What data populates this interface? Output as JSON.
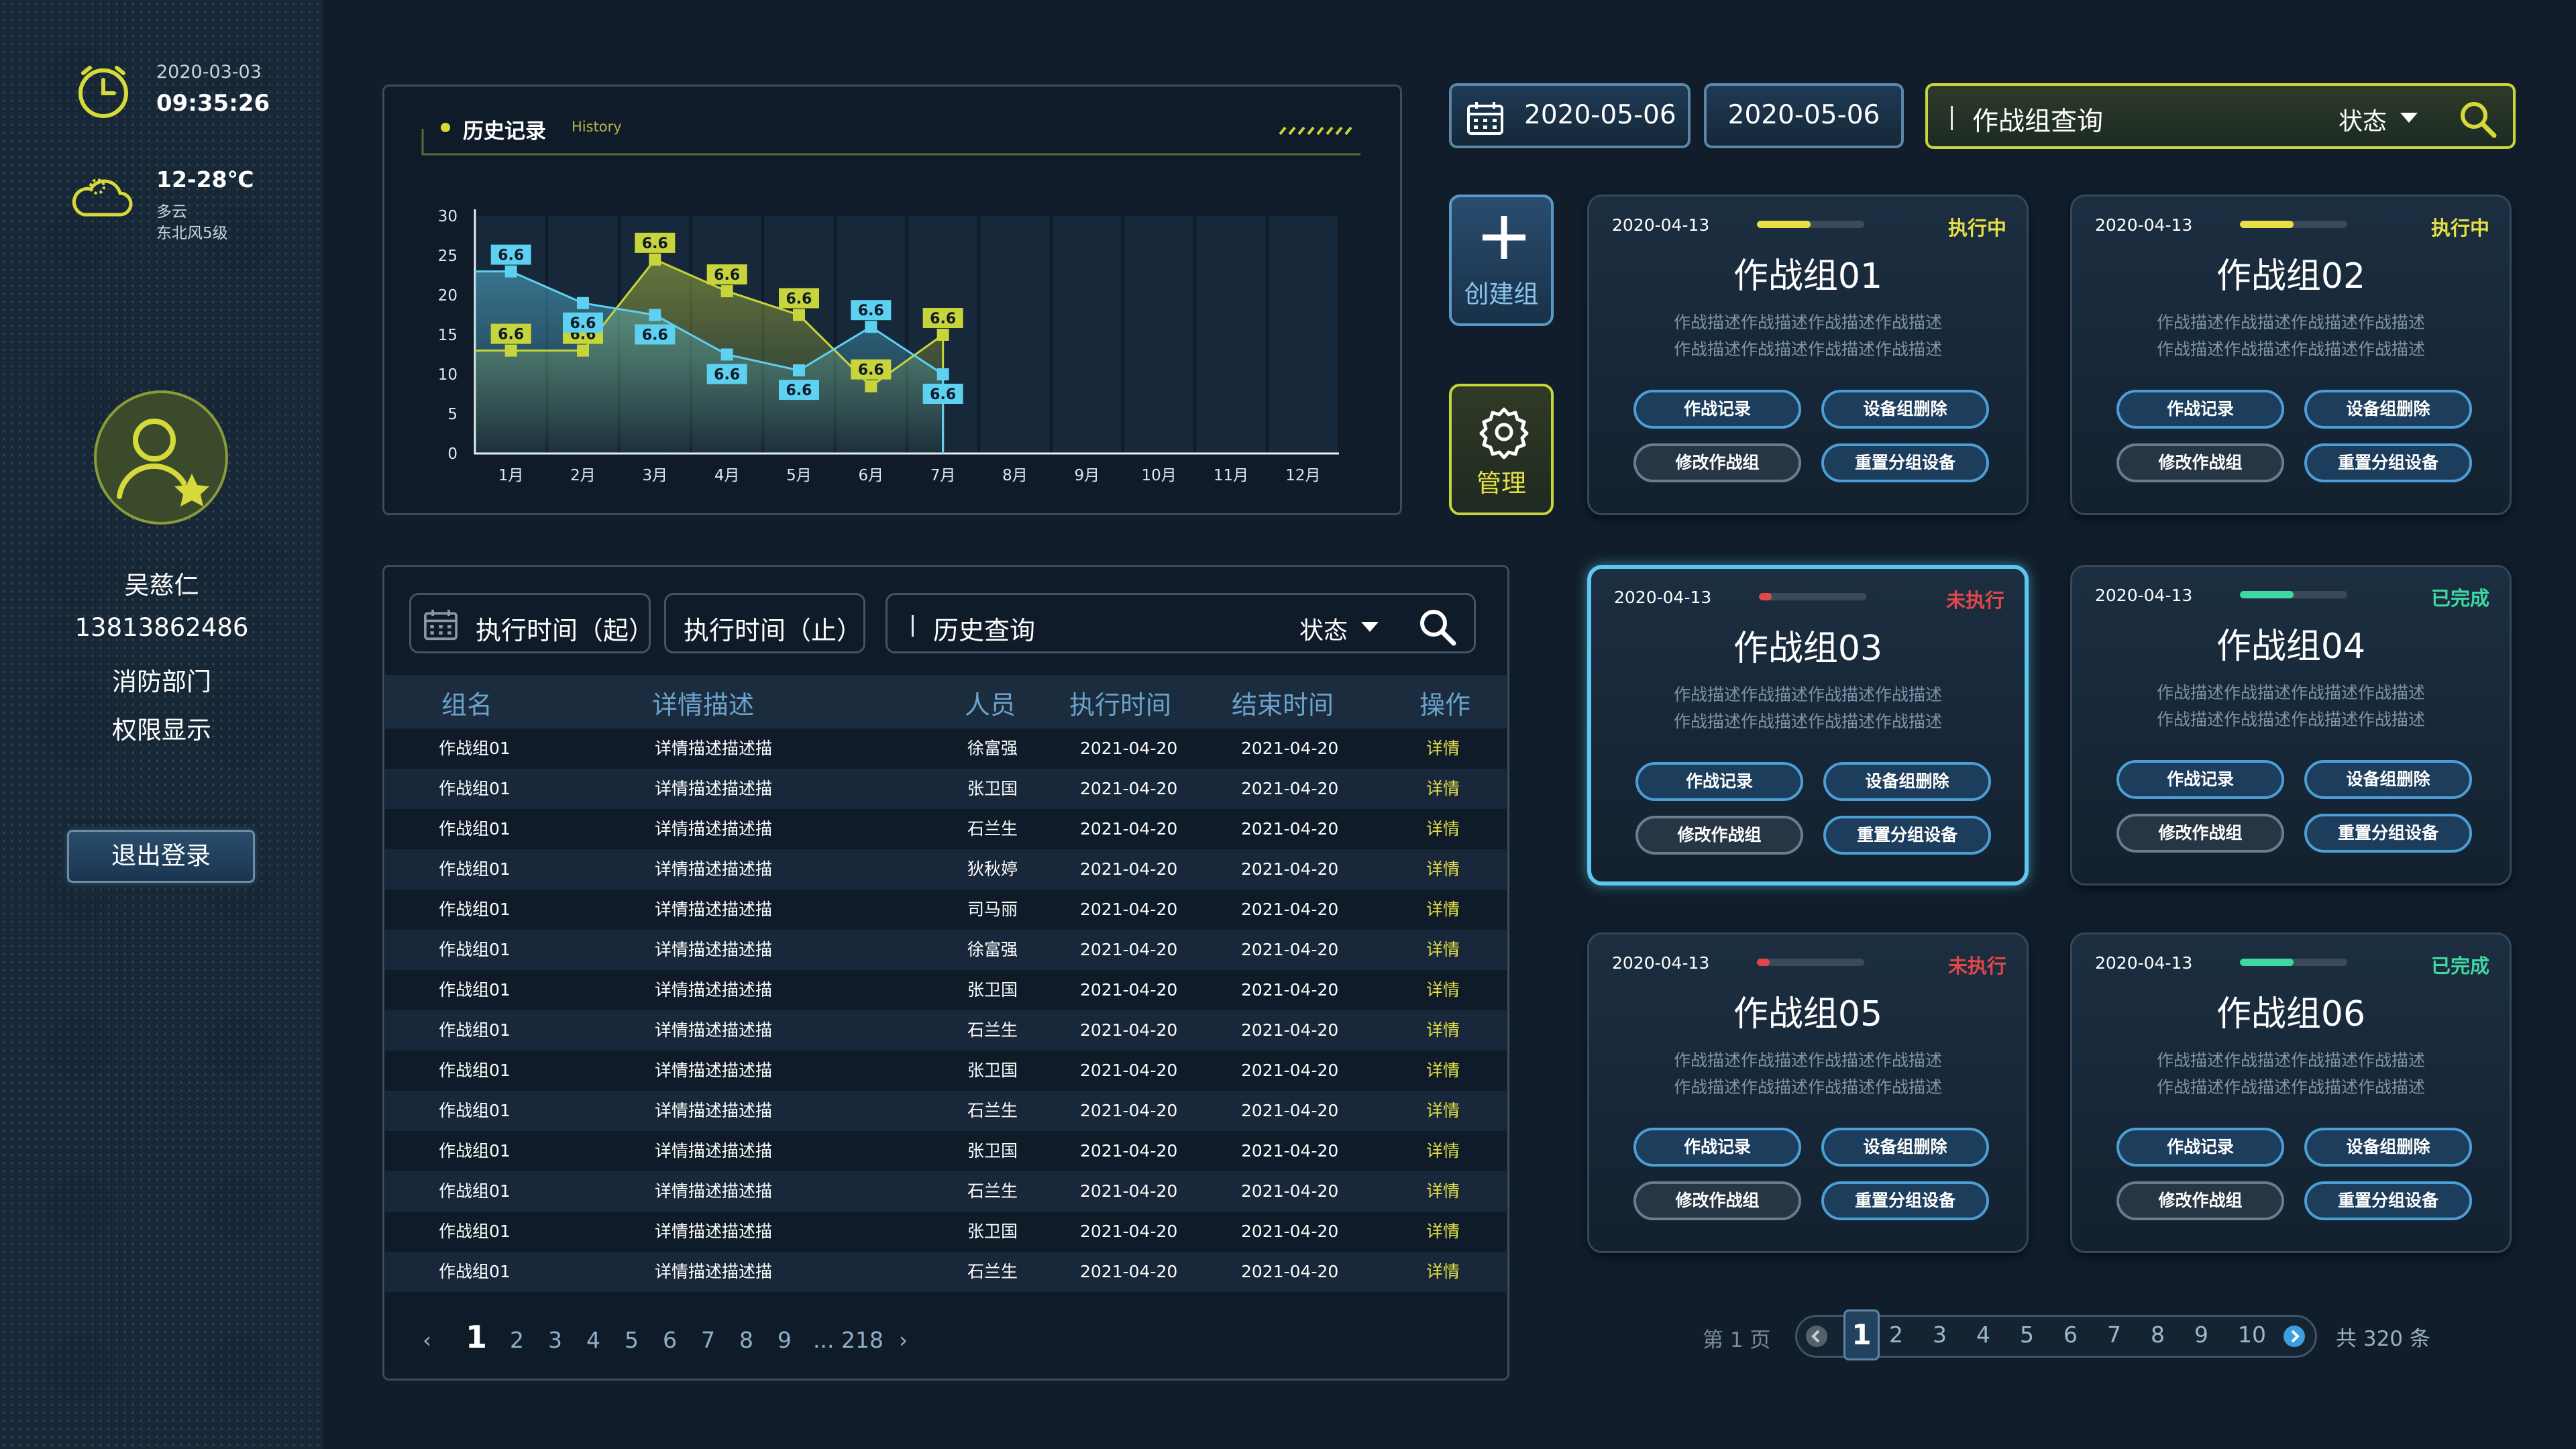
{
  "sidebar": {
    "date": "2020-03-03",
    "time": "09:35:26",
    "temp": "12-28℃",
    "weather": "多云",
    "wind": "东北风5级",
    "name": "吴慈仁",
    "phone": "13813862486",
    "department": "消防部门",
    "permission": "权限显示",
    "logout_label": "退出登录"
  },
  "chart_panel": {
    "title": "历史记录",
    "title_en": "History"
  },
  "chart_data": {
    "type": "line",
    "categories": [
      "1月",
      "2月",
      "3月",
      "4月",
      "5月",
      "6月",
      "7月",
      "8月",
      "9月",
      "10月",
      "11月",
      "12月"
    ],
    "ylim": [
      0,
      30
    ],
    "yticks": [
      0,
      5,
      10,
      15,
      20,
      25,
      30
    ],
    "series": [
      {
        "color": "#c8d53a",
        "values": [
          13,
          13,
          24.5,
          20.5,
          17.5,
          8.5,
          15
        ],
        "labels": [
          "6.6",
          "6.6",
          "6.6",
          "6.6",
          "6.6",
          "6.6",
          "6.6"
        ]
      },
      {
        "color": "#5ed0f0",
        "values": [
          23,
          19,
          17.5,
          12.5,
          10.5,
          16,
          10
        ],
        "labels": [
          "6.6",
          "6.6",
          "6.6",
          "6.6",
          "6.6",
          "6.6",
          "6.6"
        ]
      }
    ]
  },
  "topbar": {
    "date_start": "2020-05-06",
    "date_end": "2020-05-06",
    "search_placeholder": "作战组查询",
    "status_label": "状态"
  },
  "actions": {
    "create_label": "创建组",
    "manage_label": "管理"
  },
  "cards": [
    {
      "date": "2020-04-13",
      "status": "执行中",
      "status_color": "#e6e046",
      "progress": 0.5,
      "name": "作战组01",
      "desc1": "作战描述作战描述作战描述作战描述",
      "desc2": "作战描述作战描述作战描述作战描述",
      "btn1": "作战记录",
      "btn2": "设备组删除",
      "btn3": "修改作战组",
      "btn4": "重置分组设备"
    },
    {
      "date": "2020-04-13",
      "status": "执行中",
      "status_color": "#e6e046",
      "progress": 0.5,
      "name": "作战组02",
      "desc1": "作战描述作战描述作战描述作战描述",
      "desc2": "作战描述作战描述作战描述作战描述",
      "btn1": "作战记录",
      "btn2": "设备组删除",
      "btn3": "修改作战组",
      "btn4": "重置分组设备"
    },
    {
      "date": "2020-04-13",
      "status": "未执行",
      "status_color": "#e04848",
      "progress": 0.12,
      "name": "作战组03",
      "desc1": "作战描述作战描述作战描述作战描述",
      "desc2": "作战描述作战描述作战描述作战描述",
      "btn1": "作战记录",
      "btn2": "设备组删除",
      "btn3": "修改作战组",
      "btn4": "重置分组设备"
    },
    {
      "date": "2020-04-13",
      "status": "已完成",
      "status_color": "#3ed8a0",
      "progress": 0.5,
      "name": "作战组04",
      "desc1": "作战描述作战描述作战描述作战描述",
      "desc2": "作战描述作战描述作战描述作战描述",
      "btn1": "作战记录",
      "btn2": "设备组删除",
      "btn3": "修改作战组",
      "btn4": "重置分组设备"
    },
    {
      "date": "2020-04-13",
      "status": "未执行",
      "status_color": "#e04848",
      "progress": 0.12,
      "name": "作战组05",
      "desc1": "作战描述作战描述作战描述作战描述",
      "desc2": "作战描述作战描述作战描述作战描述",
      "btn1": "作战记录",
      "btn2": "设备组删除",
      "btn3": "修改作战组",
      "btn4": "重置分组设备"
    },
    {
      "date": "2020-04-13",
      "status": "已完成",
      "status_color": "#3ed8a0",
      "progress": 0.5,
      "name": "作战组06",
      "desc1": "作战描述作战描述作战描述作战描述",
      "desc2": "作战描述作战描述作战描述作战描述",
      "btn1": "作战记录",
      "btn2": "设备组删除",
      "btn3": "修改作战组",
      "btn4": "重置分组设备"
    }
  ],
  "table": {
    "filter_start": "执行时间（起）",
    "filter_end": "执行时间（止）",
    "search_placeholder": "历史查询",
    "status_label": "状态",
    "headers": [
      "组名",
      "详情描述",
      "人员",
      "执行时间",
      "结束时间",
      "操作"
    ],
    "rows": [
      [
        "作战组01",
        "详情描述描述描",
        "徐富强",
        "2021-04-20",
        "2021-04-20",
        "详情"
      ],
      [
        "作战组01",
        "详情描述描述描",
        "张卫国",
        "2021-04-20",
        "2021-04-20",
        "详情"
      ],
      [
        "作战组01",
        "详情描述描述描",
        "石兰生",
        "2021-04-20",
        "2021-04-20",
        "详情"
      ],
      [
        "作战组01",
        "详情描述描述描",
        "狄秋婷",
        "2021-04-20",
        "2021-04-20",
        "详情"
      ],
      [
        "作战组01",
        "详情描述描述描",
        "司马丽",
        "2021-04-20",
        "2021-04-20",
        "详情"
      ],
      [
        "作战组01",
        "详情描述描述描",
        "徐富强",
        "2021-04-20",
        "2021-04-20",
        "详情"
      ],
      [
        "作战组01",
        "详情描述描述描",
        "张卫国",
        "2021-04-20",
        "2021-04-20",
        "详情"
      ],
      [
        "作战组01",
        "详情描述描述描",
        "石兰生",
        "2021-04-20",
        "2021-04-20",
        "详情"
      ],
      [
        "作战组01",
        "详情描述描述描",
        "张卫国",
        "2021-04-20",
        "2021-04-20",
        "详情"
      ],
      [
        "作战组01",
        "详情描述描述描",
        "石兰生",
        "2021-04-20",
        "2021-04-20",
        "详情"
      ],
      [
        "作战组01",
        "详情描述描述描",
        "张卫国",
        "2021-04-20",
        "2021-04-20",
        "详情"
      ],
      [
        "作战组01",
        "详情描述描述描",
        "石兰生",
        "2021-04-20",
        "2021-04-20",
        "详情"
      ],
      [
        "作战组01",
        "详情描述描述描",
        "张卫国",
        "2021-04-20",
        "2021-04-20",
        "详情"
      ],
      [
        "作战组01",
        "详情描述描述描",
        "石兰生",
        "2021-04-20",
        "2021-04-20",
        "详情"
      ]
    ],
    "pagination": {
      "prev": "‹",
      "current": "1",
      "pages": [
        "2",
        "3",
        "4",
        "5",
        "6",
        "7",
        "8",
        "9"
      ],
      "last": "... 218",
      "next": "›"
    }
  },
  "card_pager": {
    "page_label": "第 1 页",
    "current": "1",
    "pages": [
      "2",
      "3",
      "4",
      "5",
      "6",
      "7",
      "8",
      "9",
      "10"
    ],
    "total_label": "共 320 条"
  }
}
